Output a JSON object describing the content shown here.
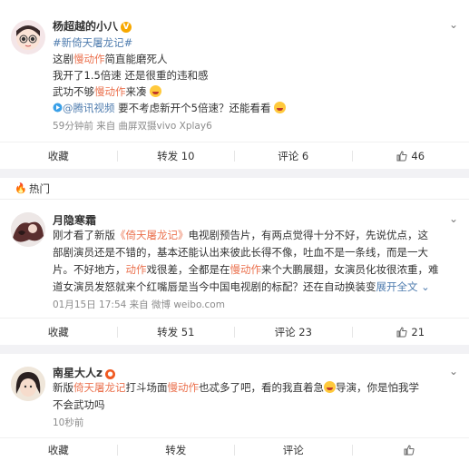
{
  "post1": {
    "username": "杨超越的小八",
    "hashtag": "#新倚天屠龙记#",
    "line1_a": "这剧",
    "line1_b": "慢动作",
    "line1_c": "简直能磨死人",
    "line2": "我开了1.5倍速 还是很重的违和感",
    "line3_a": "武功不够",
    "line3_b": "慢动作",
    "line3_c": "来凑",
    "line4_link": "@腾讯视频",
    "line4_text": "要不考虑新开个5倍速？还能看看",
    "meta": "59分钟前  来自 曲屏双摄vivo Xplay6",
    "actions": {
      "share": "收藏",
      "repost": "转发 10",
      "comment": "评论 6",
      "like": "46"
    }
  },
  "hot_label": "热门",
  "post2": {
    "username": "月隐寒霜",
    "l1_a": "刚才看了新版",
    "l1_b": "《倚天屠龙记》",
    "l1_c": "电视剧预告片，有两点觉得十分不好，先说优点，这",
    "l2": "部剧演员还是不错的，基本还能认出来彼此长得不像，吐血不是一条线，而是一大",
    "l3_a": "片。不好地方，",
    "l3_b": "动作",
    "l3_c": "戏很差，全都是在",
    "l3_d": "慢动作",
    "l3_e": "来个大鹏展翅，女演员化妆很浓重，难",
    "l4_a": "道女演员发怒就来个红嘴唇是当今中国电视剧的标配？还在自动换装变",
    "l4_b": "展开全文",
    "meta": "01月15日 17:54 来自 微博 weibo.com",
    "actions": {
      "share": "收藏",
      "repost": "转发 51",
      "comment": "评论 23",
      "like": "21"
    }
  },
  "post3": {
    "username": "南星大人z",
    "l1_a": "新版",
    "l1_b": "倚天屠龙记",
    "l1_c": "打斗场面",
    "l1_d": "慢动作",
    "l1_e": "也忒多了吧，看的我直着急",
    "l1_f": "导演，你是怕我学",
    "l2": "不会武功吗",
    "meta": "10秒前",
    "actions": {
      "share": "收藏",
      "repost": "转发",
      "comment": "评论",
      "like": ""
    }
  }
}
